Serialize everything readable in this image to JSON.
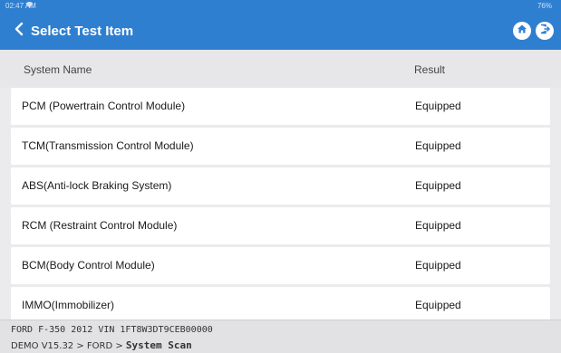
{
  "status_bar": {
    "time": "02:47 AM",
    "wifi_icon": "wifi-icon",
    "battery": "76%"
  },
  "header": {
    "title": "Select Test Item",
    "back_icon": "chevron-left-icon",
    "home_icon": "home-icon",
    "exit_icon": "exit-icon"
  },
  "columns": {
    "name": "System Name",
    "result": "Result"
  },
  "rows": [
    {
      "name": "PCM (Powertrain Control Module)",
      "result": "Equipped"
    },
    {
      "name": "TCM(Transmission Control Module)",
      "result": "Equipped"
    },
    {
      "name": "ABS(Anti-lock Braking System)",
      "result": "Equipped"
    },
    {
      "name": "RCM (Restraint Control Module)",
      "result": "Equipped"
    },
    {
      "name": "BCM(Body Control Module)",
      "result": "Equipped"
    },
    {
      "name": "IMMO(Immobilizer)",
      "result": "Equipped"
    }
  ],
  "footer": {
    "vehicle": "FORD  F-350  2012  VIN  1FT8W3DT9CEB00000",
    "path": "DEMO V15.32 > FORD > ",
    "current": "System Scan"
  },
  "colors": {
    "accent": "#2f7fd0",
    "background": "#ebebed"
  }
}
